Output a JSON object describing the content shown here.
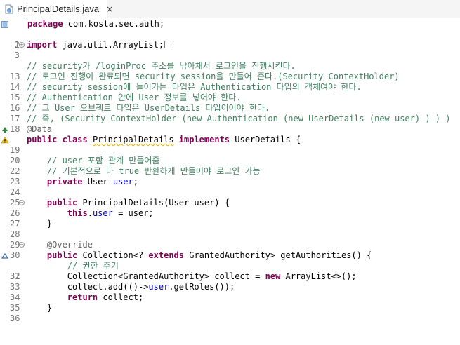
{
  "tab": {
    "filename": "PrincipalDetails.java",
    "close_glyph": "×"
  },
  "lines": {
    "l1": {
      "num": "1",
      "t0": "package",
      "t1": " com.kosta.sec.auth;"
    },
    "l2": {
      "num": "2"
    },
    "l3": {
      "num": "3",
      "fold": "+",
      "t0": "import",
      "t1": " java.util.ArrayList;"
    },
    "l13": {
      "num": "13",
      "text": "// security가 /loginProc 주소를 낚아채서 로그인을 진행시킨다."
    },
    "l14": {
      "num": "14",
      "text": "// 로그인 진행이 완료되면 security session을 만들어 준다.(Security ContextHolder)"
    },
    "l15": {
      "num": "15",
      "text": "// security session에 들어가는 타입은 Authentication 타입의 객체여야 한다."
    },
    "l16": {
      "num": "16",
      "text": "// Authentication 안에 User 정보를 넣어야 한다."
    },
    "l17": {
      "num": "17",
      "text": "// 그 User 오브젝트 타입은 UserDetails 타입이어야 한다."
    },
    "l18": {
      "num": "18",
      "text": "// 즉, (Security ContextHolder (new Authentication (new UserDetails (new user) ) ) )"
    },
    "l19": {
      "num": "19",
      "text": "@Data"
    },
    "l20": {
      "num": "20",
      "t0": "public",
      "t1": "class",
      "t2": "PrincipalDetails",
      "t3": "implements",
      "t4": " UserDetails {"
    },
    "l21": {
      "num": "21"
    },
    "l22": {
      "num": "22",
      "text": "    // user 포함 관계 만들어줌"
    },
    "l23": {
      "num": "23",
      "text": "    // 기본적으로 다 true 반환하게 만들어야 로그인 가능"
    },
    "l24": {
      "num": "24",
      "t0": "private",
      "t1": " User ",
      "t2": "user",
      "t3": ";"
    },
    "l25": {
      "num": "25"
    },
    "l26": {
      "num": "26",
      "fold": "−",
      "t0": "public",
      "t1": " PrincipalDetails(User user) {"
    },
    "l27": {
      "num": "27",
      "t0": "this",
      "t1": ".",
      "t2": "user",
      "t3": " = user;"
    },
    "l28": {
      "num": "28",
      "text": "    }"
    },
    "l29": {
      "num": "29"
    },
    "l30": {
      "num": "30",
      "fold": "−",
      "text": "    @Override"
    },
    "l31": {
      "num": "31",
      "t0": "public",
      "t1": " Collection<? ",
      "t2": "extends",
      "t3": " GrantedAuthority> getAuthorities() {"
    },
    "l32": {
      "num": "32",
      "text": "        // 권한 주기"
    },
    "l33": {
      "num": "33",
      "t0": "        Collection<GrantedAuthority> collect = ",
      "t1": "new",
      "t2": " ArrayList<>();"
    },
    "l34": {
      "num": "34",
      "t0": "        collect.add(()->",
      "t1": "user",
      "t2": ".getRoles());"
    },
    "l35": {
      "num": "35",
      "t0": "return",
      "t1": " collect;"
    },
    "l36": {
      "num": "36",
      "text": "    }"
    }
  },
  "colors": {
    "keyword": "#7f0055",
    "comment": "#3f7f5f",
    "field": "#0000c0",
    "annotation": "#646464",
    "line_number": "#787878"
  },
  "icons": {
    "tab": "java-file-icon",
    "gutter_1": "bookmark-icon",
    "gutter_19": "override-up-arrow-icon",
    "gutter_20": "warning-icon",
    "gutter_31": "override-triangle-icon"
  }
}
